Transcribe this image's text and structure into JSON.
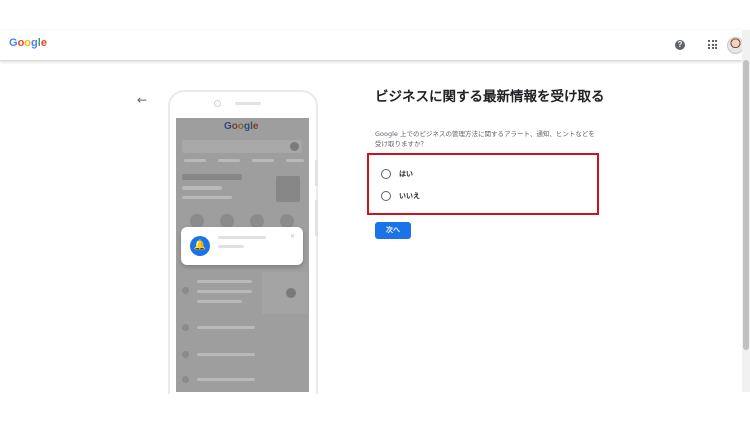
{
  "header": {
    "logo": [
      "G",
      "o",
      "o",
      "g",
      "l",
      "e"
    ],
    "help_icon": "?",
    "apps_icon": "grid-icon",
    "avatar": "account-avatar"
  },
  "phone_preview": {
    "logo": [
      "G",
      "o",
      "o",
      "g",
      "l",
      "e"
    ]
  },
  "main": {
    "title": "ビジネスに関する最新情報を受け取る",
    "description": "Google 上でのビジネスの管理方法に関するアラート、通知、ヒントなどを受け取りますか？",
    "options": [
      {
        "label": "はい",
        "selected": false
      },
      {
        "label": "いいえ",
        "selected": false
      }
    ],
    "next_button": "次へ"
  },
  "colors": {
    "accent": "#1a73e8",
    "highlight_box": "#d0121b"
  }
}
